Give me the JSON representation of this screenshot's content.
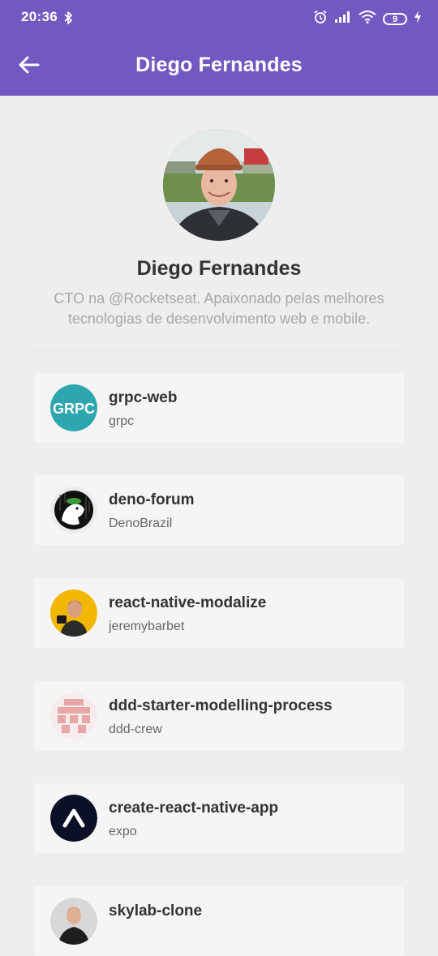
{
  "status_bar": {
    "time": "20:36",
    "battery": "9",
    "icons": [
      "bluetooth-icon",
      "alarm-icon",
      "signal-icon",
      "wifi-icon",
      "battery-icon",
      "charging-icon"
    ]
  },
  "app_bar": {
    "title": "Diego Fernandes",
    "back_icon": "arrow-left-icon",
    "color": "#7159c1"
  },
  "profile": {
    "name": "Diego Fernandes",
    "bio": "CTO na @Rocketseat. Apaixonado pelas melhores tecnologias de desenvolvimento web e mobile."
  },
  "repos": [
    {
      "title": "grpc-web",
      "owner": "grpc",
      "avatar": "grpc-logo"
    },
    {
      "title": "deno-forum",
      "owner": "DenoBrazil",
      "avatar": "deno-logo"
    },
    {
      "title": "react-native-modalize",
      "owner": "jeremybarbet",
      "avatar": "user-photo"
    },
    {
      "title": "ddd-starter-modelling-process",
      "owner": "ddd-crew",
      "avatar": "ddd-crew-logo"
    },
    {
      "title": "create-react-native-app",
      "owner": "expo",
      "avatar": "expo-logo"
    },
    {
      "title": "skylab-clone",
      "owner": "",
      "avatar": "user-photo"
    }
  ]
}
